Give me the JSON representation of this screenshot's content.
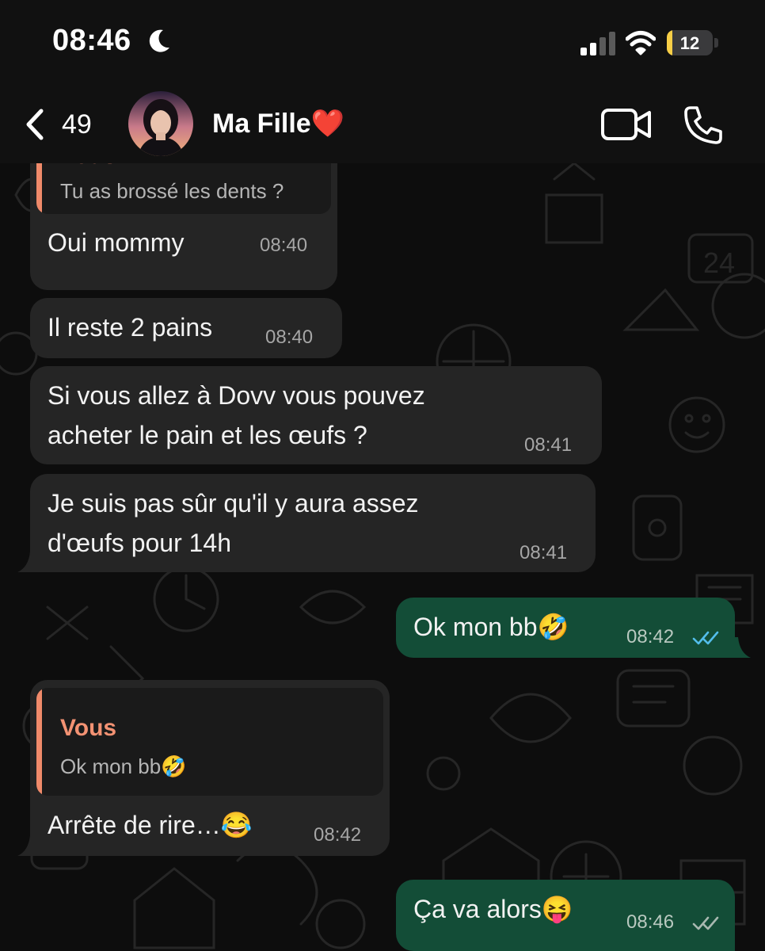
{
  "status_bar": {
    "time": "08:46",
    "battery_percent": "12",
    "battery_level": 0.12,
    "battery_color": "#f7ce46",
    "icons": [
      "moon-icon",
      "signal-icon",
      "wifi-icon",
      "battery-icon"
    ]
  },
  "header": {
    "back_count": "49",
    "contact_name": "Ma Fille❤️",
    "icons": [
      "chevron-left-icon",
      "video-camera-icon",
      "phone-icon"
    ]
  },
  "colors": {
    "incoming_bubble": "#252525",
    "outgoing_bubble": "#134d37",
    "quote_accent": "#f39273",
    "read_tick": "#53bdeb",
    "delivered_tick": "#a8b8b0"
  },
  "messages": [
    {
      "direction": "in",
      "quote": {
        "author": "Vous",
        "text": "Tu as brossé les dents ?"
      },
      "text": "Oui mommy",
      "time": "08:40"
    },
    {
      "direction": "in",
      "text": "Il reste 2 pains",
      "time": "08:40"
    },
    {
      "direction": "in",
      "lines": [
        "Si vous allez à Dovv vous pouvez",
        "acheter le pain et les œufs ?"
      ],
      "time": "08:41"
    },
    {
      "direction": "in",
      "lines": [
        "Je suis pas sûr qu'il y aura assez",
        "d'œufs pour 14h"
      ],
      "time": "08:41"
    },
    {
      "direction": "out",
      "text": "Ok mon bb🤣",
      "time": "08:42",
      "status": "read"
    },
    {
      "direction": "in",
      "quote": {
        "author": "Vous",
        "text": "Ok mon bb🤣"
      },
      "text": "Arrête de rire…😂",
      "time": "08:42"
    },
    {
      "direction": "out",
      "text": "Ça va alors😝",
      "time": "08:46",
      "status": "delivered"
    }
  ]
}
